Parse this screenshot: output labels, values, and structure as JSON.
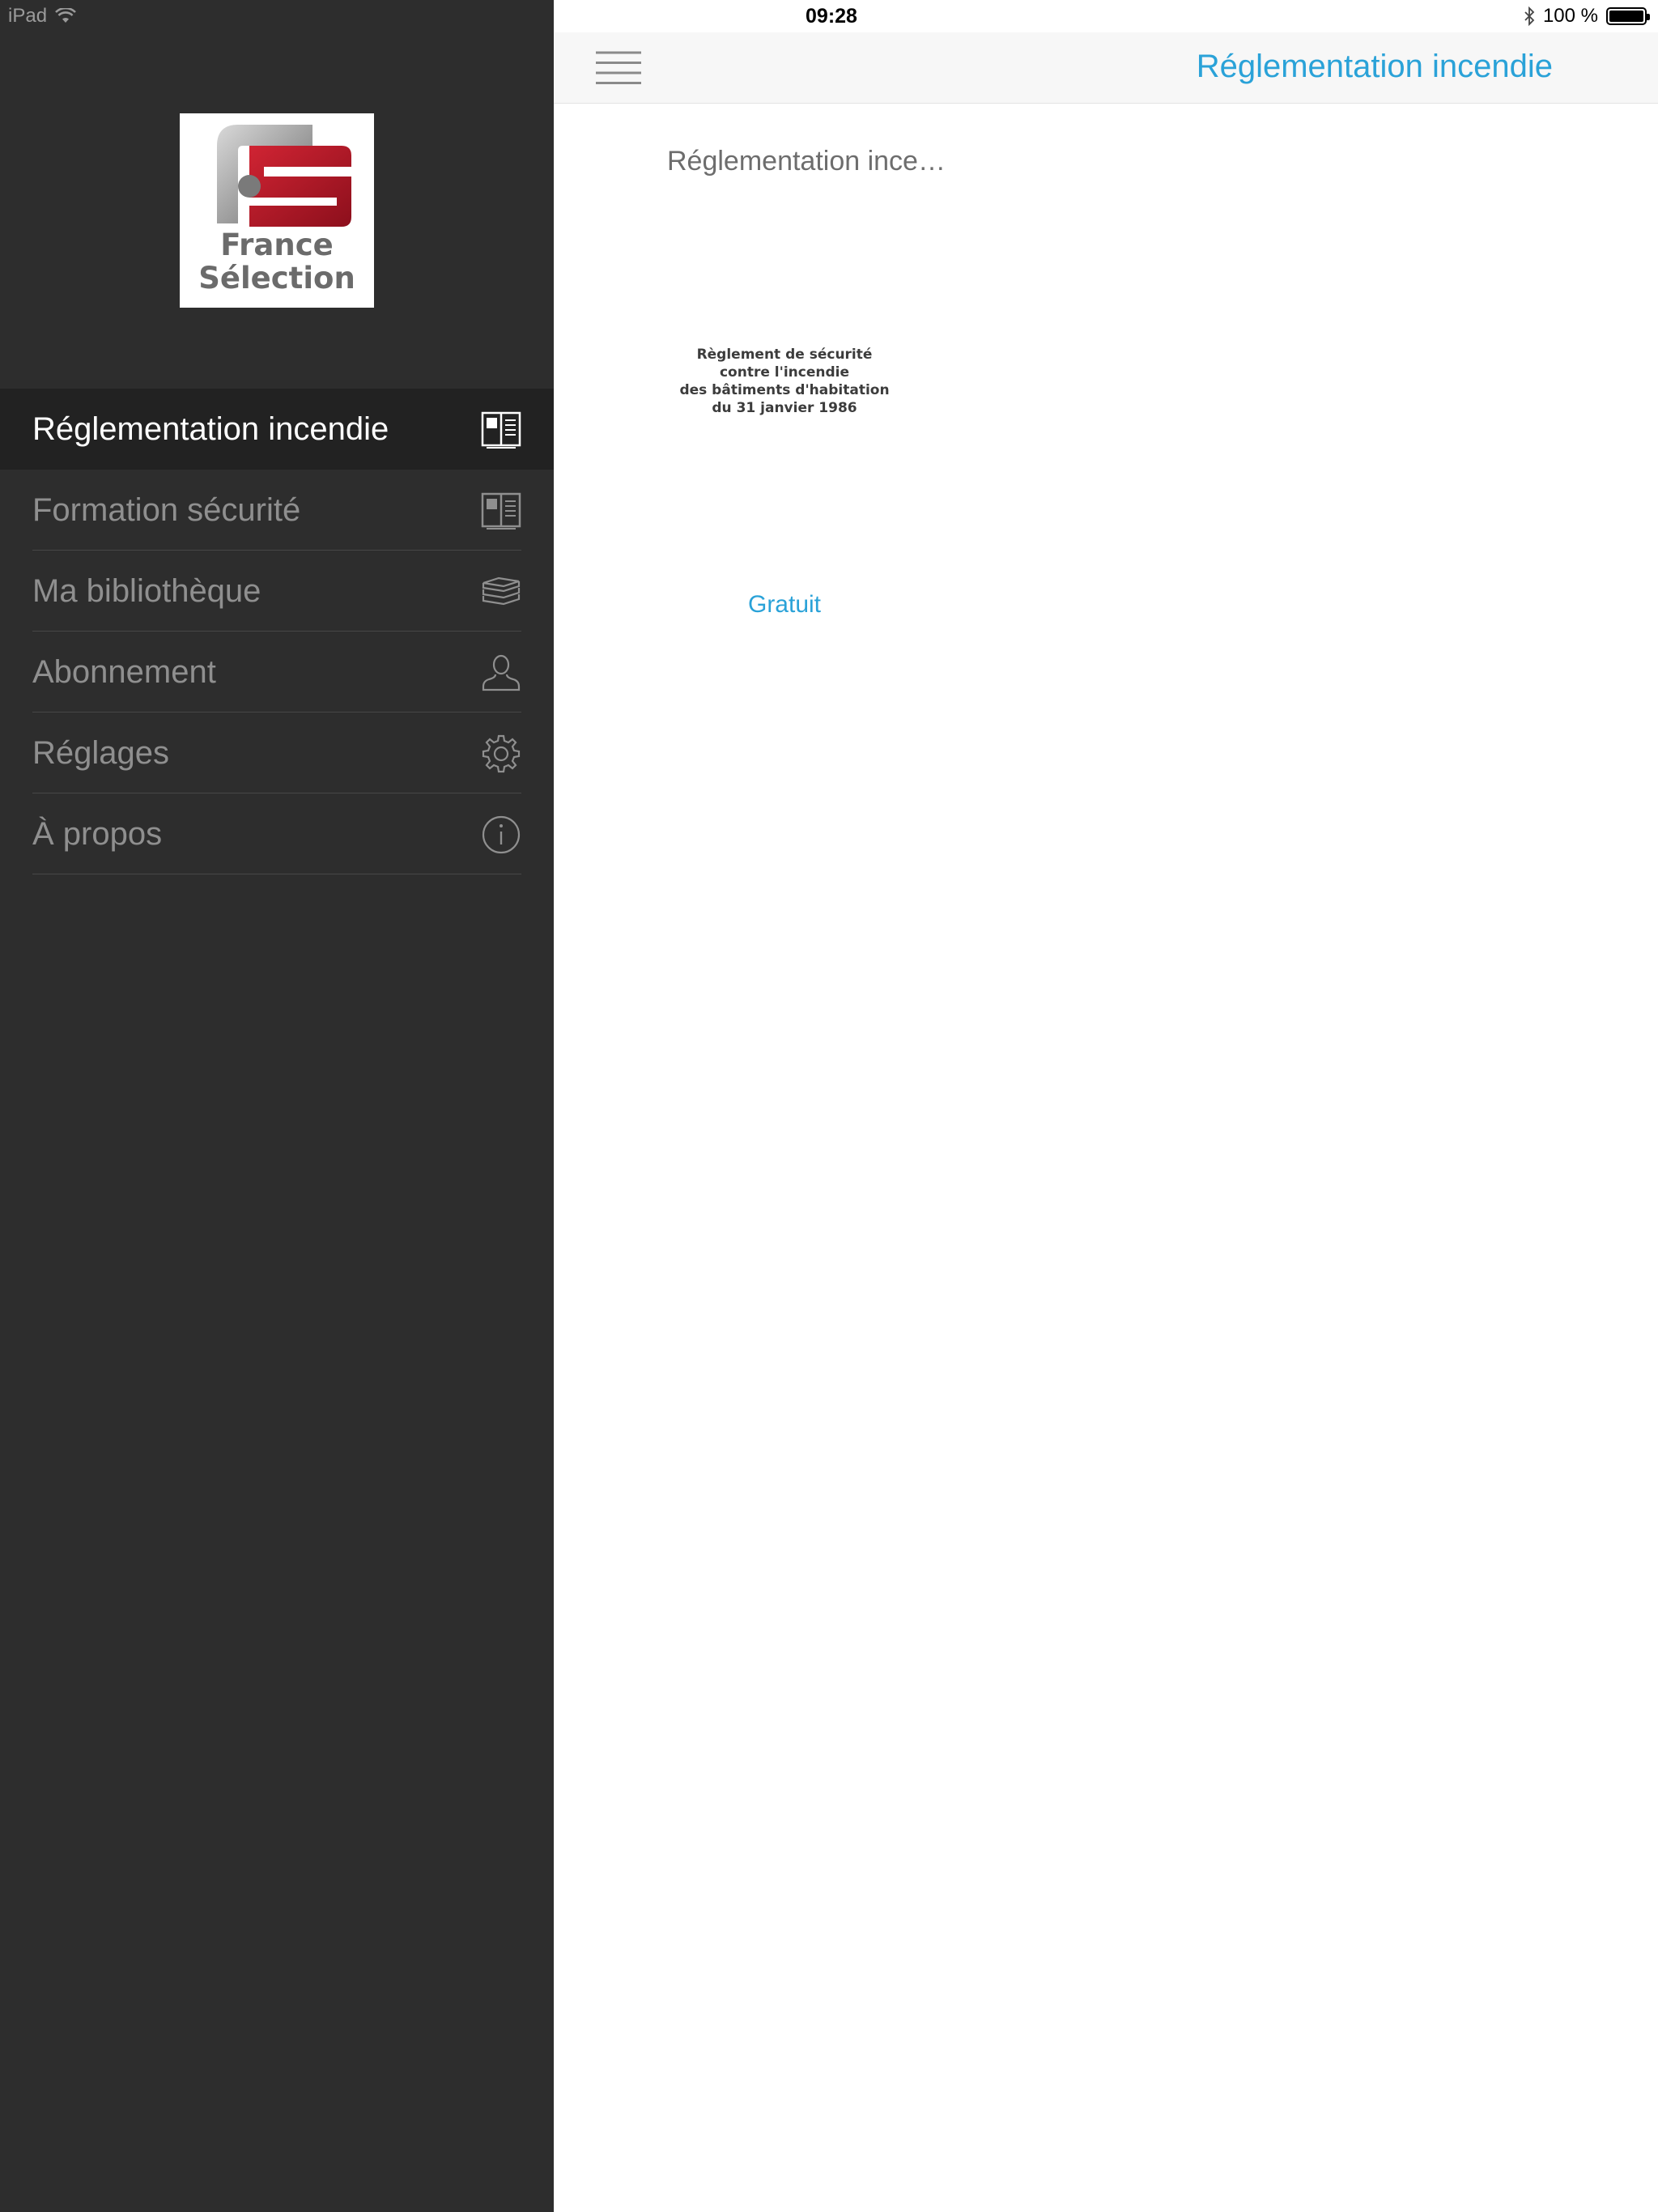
{
  "status_bar": {
    "device": "iPad",
    "time": "09:28",
    "battery_text": "100 %",
    "battery_level": 1.0
  },
  "sidebar": {
    "logo": {
      "line1": "France",
      "line2": "Sélection"
    },
    "items": [
      {
        "label": "Réglementation incendie",
        "icon": "book-icon",
        "active": true
      },
      {
        "label": "Formation sécurité",
        "icon": "book-icon",
        "active": false
      },
      {
        "label": "Ma bibliothèque",
        "icon": "stack-icon",
        "active": false
      },
      {
        "label": "Abonnement",
        "icon": "user-icon",
        "active": false
      },
      {
        "label": "Réglages",
        "icon": "gear-icon",
        "active": false
      },
      {
        "label": "À propos",
        "icon": "info-icon",
        "active": false
      }
    ]
  },
  "navbar": {
    "title": "Réglementation incendie"
  },
  "book": {
    "title": "Réglementation ince…",
    "cover_lines": [
      "Règlement de sécurité",
      "contre l'incendie",
      "des bâtiments d'habitation",
      "du 31 janvier 1986"
    ],
    "price": "Gratuit"
  },
  "colors": {
    "accent": "#2aa2d8",
    "sidebar_bg": "#2d2d2d",
    "sidebar_active_bg": "#222222",
    "logo_red": "#b01a2a"
  }
}
